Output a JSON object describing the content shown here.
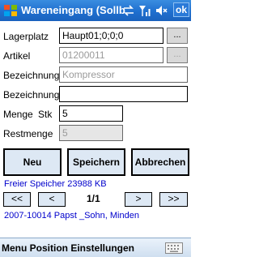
{
  "titlebar": {
    "title": "Wareneingang (Sollb",
    "ok_label": "ok"
  },
  "form": {
    "lagerplatz": {
      "label": "Lagerplatz",
      "value": "Haupt01;0;0;0",
      "browse_label": "..."
    },
    "artikel": {
      "label": "Artikel",
      "placeholder": "01200011",
      "browse_label": "..."
    },
    "bezeichnung1": {
      "label": "Bezeichnung",
      "placeholder": "Kompressor"
    },
    "bezeichnung2": {
      "label": "Bezeichnung",
      "value": ""
    },
    "menge": {
      "label": "Menge",
      "unit": "Stk",
      "value": "5"
    },
    "restmenge": {
      "label": "Restmenge",
      "value": "5"
    }
  },
  "buttons": {
    "neu": "Neu",
    "speichern": "Speichern",
    "abbrechen": "Abbrechen"
  },
  "status": {
    "memory": "Freier Speicher 23988 KB",
    "record": "2007-10014  Papst _Sohn, Minden"
  },
  "nav": {
    "first": "<<",
    "prev": "<",
    "page": "1/1",
    "next": ">",
    "last": ">>"
  },
  "menubar": {
    "items": "Menu Position Einstellungen"
  },
  "colors": {
    "titlebar": "#1f6fcf",
    "button_bg": "#dde8f4",
    "link_text": "#0000cc"
  },
  "icons": [
    "windows-start-icon",
    "sync-icon",
    "signal-icon",
    "volume-icon",
    "keyboard-icon"
  ]
}
